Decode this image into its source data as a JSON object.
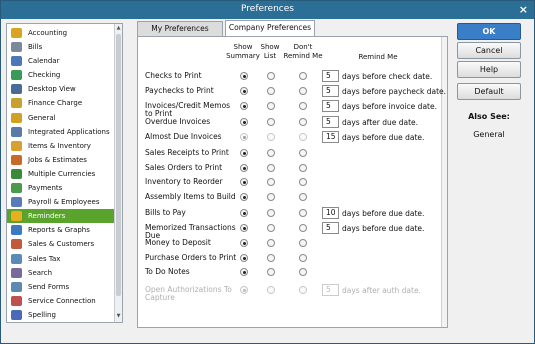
{
  "window": {
    "title": "Preferences",
    "close": "×"
  },
  "sidebar": {
    "items": [
      {
        "label": "Accounting",
        "color": "#d9a520"
      },
      {
        "label": "Bills",
        "color": "#7a8a9a"
      },
      {
        "label": "Calendar",
        "color": "#4a78b8"
      },
      {
        "label": "Checking",
        "color": "#3a9a5a"
      },
      {
        "label": "Desktop View",
        "color": "#4a6a9a"
      },
      {
        "label": "Finance Charge",
        "color": "#c8a030"
      },
      {
        "label": "General",
        "color": "#d0a020"
      },
      {
        "label": "Integrated Applications",
        "color": "#5a7aa8"
      },
      {
        "label": "Items & Inventory",
        "color": "#d8a030"
      },
      {
        "label": "Jobs & Estimates",
        "color": "#c86a2a"
      },
      {
        "label": "Multiple Currencies",
        "color": "#3a8a3a"
      },
      {
        "label": "Payments",
        "color": "#4a9a4a"
      },
      {
        "label": "Payroll & Employees",
        "color": "#5a7ab8"
      },
      {
        "label": "Reminders",
        "color": "#e8b020",
        "selected": true
      },
      {
        "label": "Reports & Graphs",
        "color": "#3a7ac0"
      },
      {
        "label": "Sales & Customers",
        "color": "#c05a3a"
      },
      {
        "label": "Sales Tax",
        "color": "#5a8ab8"
      },
      {
        "label": "Search",
        "color": "#7a6a9a"
      },
      {
        "label": "Send Forms",
        "color": "#5a8ab0"
      },
      {
        "label": "Service Connection",
        "color": "#c05050"
      },
      {
        "label": "Spelling",
        "color": "#4a6ab8"
      }
    ]
  },
  "tabs": {
    "my": "My Preferences",
    "company": "Company Preferences"
  },
  "headers": {
    "summary": "Show\nSummary",
    "list": "Show\nList",
    "dont": "Don't\nRemind Me",
    "remind": "Remind Me"
  },
  "rows": [
    {
      "label": "Checks to Print",
      "sel": "summary",
      "days": "5",
      "suffix": "days before check date."
    },
    {
      "label": "Paychecks to Print",
      "sel": "summary",
      "days": "5",
      "suffix": "days before paycheck date."
    },
    {
      "label": "Invoices/Credit Memos to Print",
      "sel": "summary",
      "days": "5",
      "suffix": "days before invoice date."
    },
    {
      "label": "Overdue Invoices",
      "sel": "summary",
      "days": "5",
      "suffix": "days after due date."
    },
    {
      "label": "Almost Due Invoices",
      "sel": "summary",
      "days": "15",
      "suffix": "days before due date.",
      "disabled_radios": true
    },
    {
      "label": "Sales Receipts to Print",
      "sel": "summary"
    },
    {
      "label": "Sales Orders to Print",
      "sel": "summary"
    },
    {
      "label": "Inventory to Reorder",
      "sel": "summary"
    },
    {
      "label": "Assembly Items to Build",
      "sel": "summary"
    },
    {
      "label": "Bills to Pay",
      "sel": "summary",
      "days": "10",
      "suffix": "days before due date."
    },
    {
      "label": "Memorized Transactions Due",
      "sel": "summary",
      "days": "5",
      "suffix": "days before due date."
    },
    {
      "label": "Money to Deposit",
      "sel": "summary"
    },
    {
      "label": "Purchase Orders to Print",
      "sel": "summary"
    },
    {
      "label": "To Do Notes",
      "sel": "summary"
    },
    {
      "label": "Open Authorizations To Capture",
      "sel": "summary",
      "days": "5",
      "suffix": "days after auth date.",
      "disabled": true
    }
  ],
  "buttons": {
    "ok": "OK",
    "cancel": "Cancel",
    "help": "Help",
    "default": "Default"
  },
  "also_see": {
    "heading": "Also See:",
    "item": "General"
  }
}
